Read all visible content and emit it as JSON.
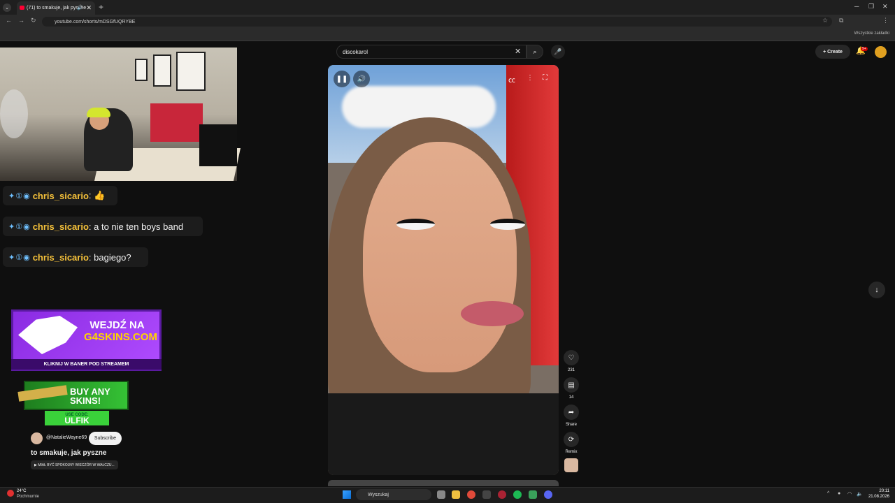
{
  "browser": {
    "tab_title": "(71) to smakuje, jak pyszne",
    "tab_close": "✕",
    "new_tab": "+",
    "url": "youtube.com/shorts/mDSGfUQRYBE",
    "bookmarks_label": "Wszystkie zakładki"
  },
  "youtube": {
    "search_value": "discokarol",
    "create_label": "Create",
    "notif_badge": "9+"
  },
  "chat": [
    {
      "user": "chris_sicario",
      "text": ": 👍"
    },
    {
      "user": "chris_sicario",
      "text": ": a to nie ten boys band"
    },
    {
      "user": "chris_sicario",
      "text": ": bagiego?"
    }
  ],
  "ads": {
    "g4_line1": "WEJDŹ NA",
    "g4_line2": "G4SKINS.COM",
    "g4_strip": "KLIKNIJ W BANER POD STREAMEM",
    "skins_line1": "BUY ANY",
    "skins_line2": "SKINS!",
    "skins_code_label": "USE CODE:",
    "skins_code": "ULFIK"
  },
  "short": {
    "channel": "@NatalieWayne69",
    "subscribe": "Subscribe",
    "title": "to smakuje, jak pyszne",
    "sound": "▶ MIAŁ BYĆ SPOKOJNY WIECZÓR W WAŁCZU..."
  },
  "rail": {
    "likes": "231",
    "comments": "14",
    "share": "Share",
    "remix": "Remix"
  },
  "taskbar": {
    "temp": "24°C",
    "weather": "Pochmurnie",
    "search": "Wyszukaj",
    "time": "20:11",
    "date": "21.08.2026"
  },
  "colors": {
    "accent_red": "#ff0033",
    "chat_user": "#f5c13a"
  }
}
